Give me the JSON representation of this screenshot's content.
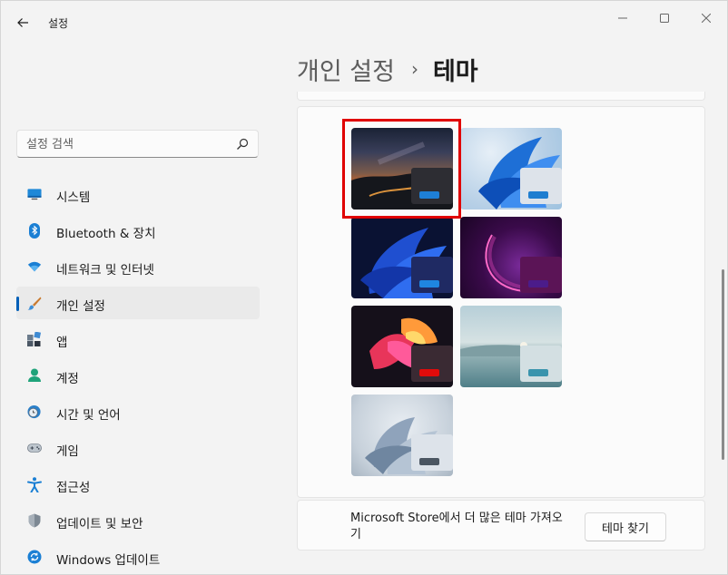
{
  "app": {
    "title": "설정"
  },
  "header": {
    "parent": "개인 설정",
    "separator": "›",
    "current": "테마"
  },
  "search": {
    "placeholder": "설정 검색"
  },
  "sidebar": {
    "items": [
      {
        "label": "시스템",
        "icon": "monitor-icon",
        "active": false
      },
      {
        "label": "Bluetooth & 장치",
        "icon": "bluetooth-icon",
        "active": false
      },
      {
        "label": "네트워크 및 인터넷",
        "icon": "wifi-icon",
        "active": false
      },
      {
        "label": "개인 설정",
        "icon": "brush-icon",
        "active": true
      },
      {
        "label": "앱",
        "icon": "apps-icon",
        "active": false
      },
      {
        "label": "계정",
        "icon": "account-icon",
        "active": false
      },
      {
        "label": "시간 및 언어",
        "icon": "clock-globe-icon",
        "active": false
      },
      {
        "label": "게임",
        "icon": "gamepad-icon",
        "active": false
      },
      {
        "label": "접근성",
        "icon": "accessibility-icon",
        "active": false
      },
      {
        "label": "업데이트 및 보안",
        "icon": "shield-icon",
        "active": false
      },
      {
        "label": "Windows 업데이트",
        "icon": "refresh-icon",
        "active": false
      }
    ]
  },
  "themes": {
    "selected_index": 0,
    "items": [
      {
        "name": "night-sky",
        "accent": "#1e7fd6",
        "card": "#2d2d33"
      },
      {
        "name": "windows-light",
        "accent": "#1f7ed0",
        "card": "#dde3ea"
      },
      {
        "name": "windows-dark",
        "accent": "#1f86e0",
        "card": "#1f2a63"
      },
      {
        "name": "glow",
        "accent": "#4b1c8a",
        "card": "#5b1456"
      },
      {
        "name": "captured-motion",
        "accent": "#e10b0b",
        "card": "#3a2a33"
      },
      {
        "name": "sunrise",
        "accent": "#3a94ad",
        "card": "#d3dfe2"
      },
      {
        "name": "flow",
        "accent": "#4b5662",
        "card": "#dde3ea"
      }
    ]
  },
  "store": {
    "text": "Microsoft Store에서 더 많은 테마 가져오기",
    "button_label": "테마 찾기"
  },
  "colors": {
    "accent": "#005fb8",
    "selection_highlight": "#e00000"
  }
}
